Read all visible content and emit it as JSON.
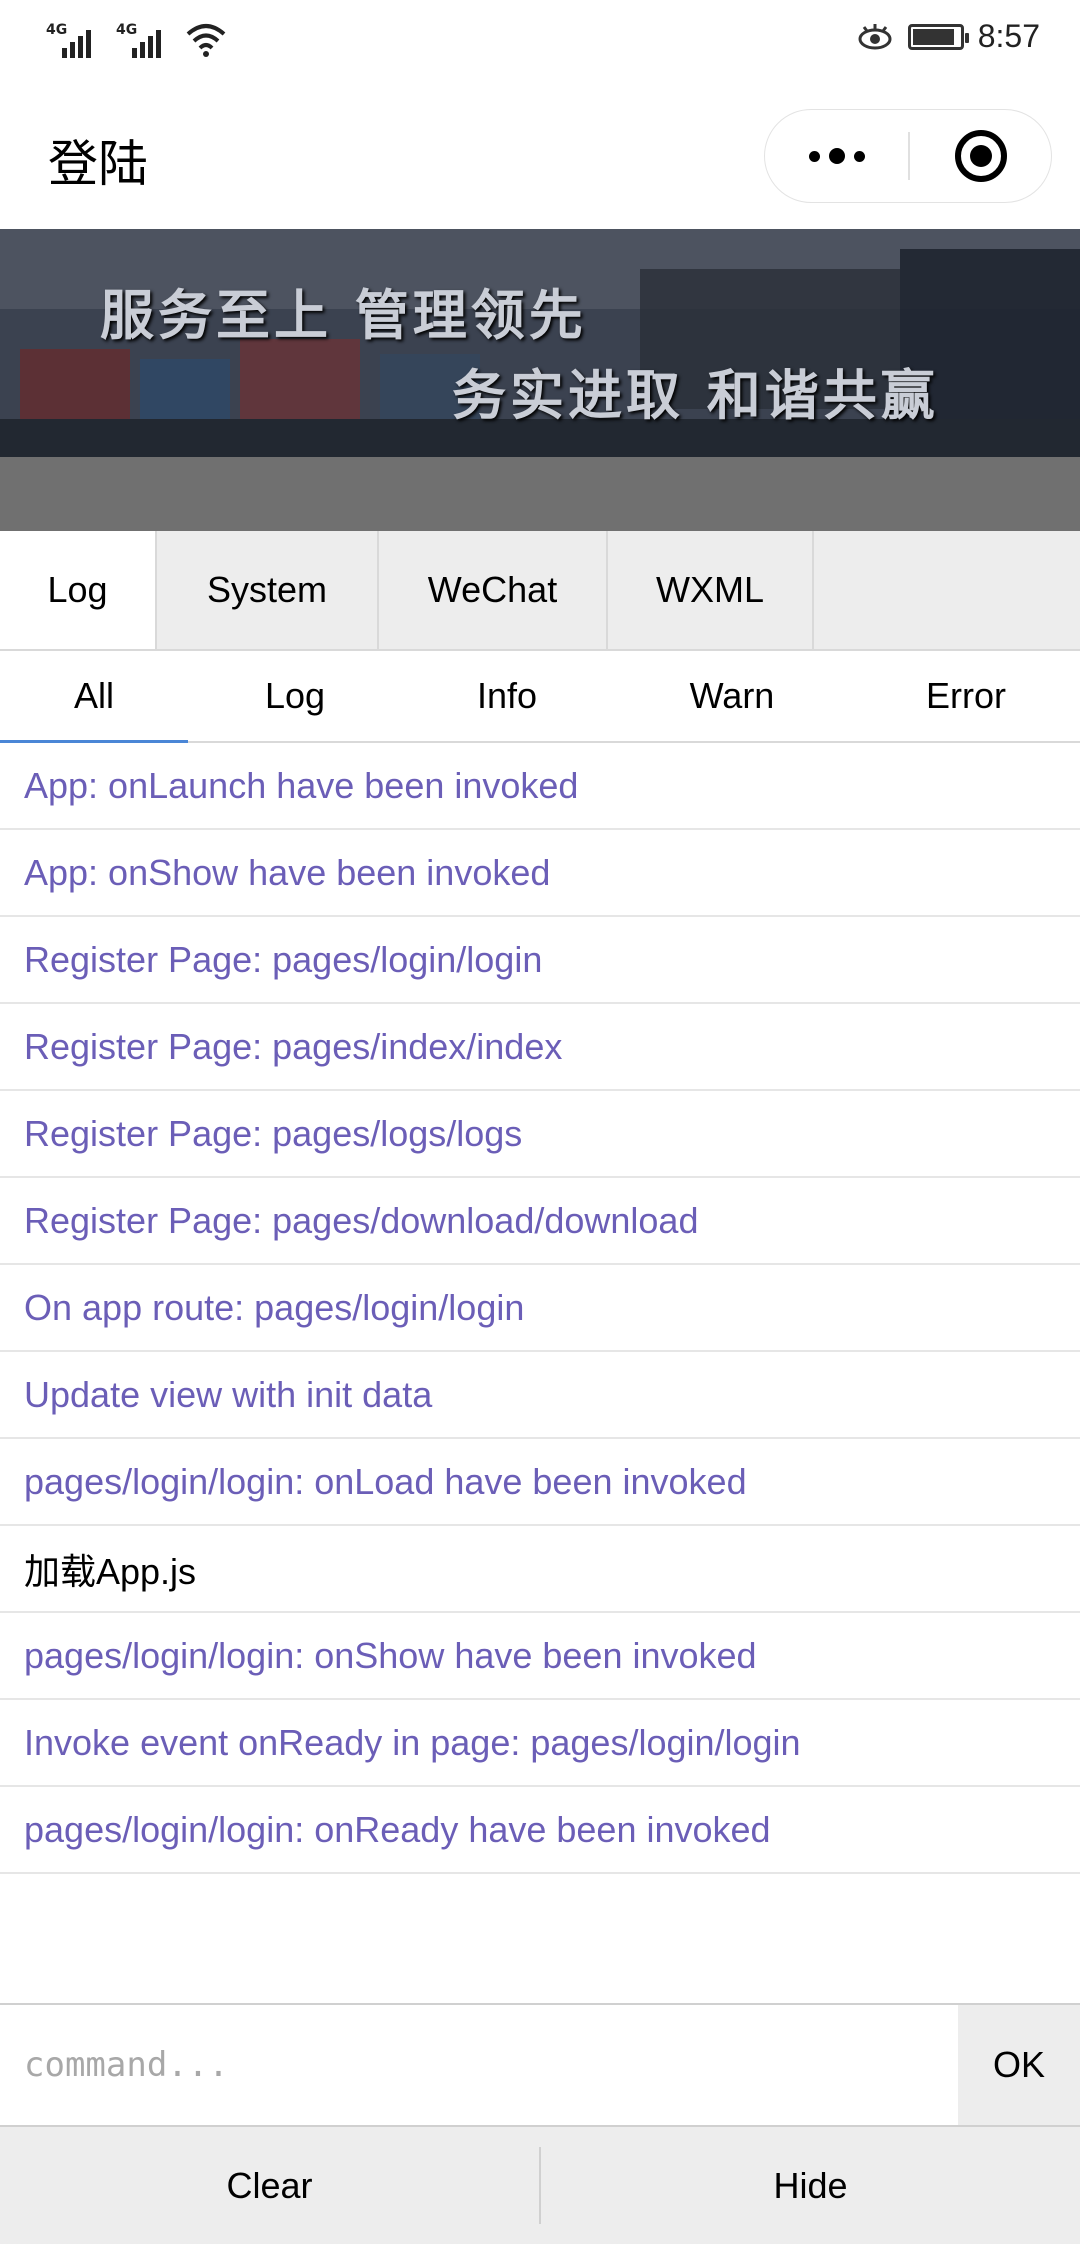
{
  "status_bar": {
    "signal1_label": "4G",
    "signal2_label": "4G",
    "time": "8:57",
    "battery_level": 0.9,
    "icons": [
      "signal-icon",
      "signal-icon",
      "wifi-icon",
      "eye-icon",
      "battery-icon"
    ]
  },
  "nav": {
    "title": "登陆",
    "more_icon": "more-dots-icon",
    "close_icon": "target-close-icon"
  },
  "banner": {
    "line1": "服务至上 管理领先",
    "line2": "务实进取 和谐共赢"
  },
  "console": {
    "tabs": [
      {
        "label": "Log",
        "active": true
      },
      {
        "label": "System",
        "active": false
      },
      {
        "label": "WeChat",
        "active": false
      },
      {
        "label": "WXML",
        "active": false
      }
    ],
    "subtabs": [
      {
        "label": "All",
        "active": true
      },
      {
        "label": "Log",
        "active": false
      },
      {
        "label": "Info",
        "active": false
      },
      {
        "label": "Warn",
        "active": false
      },
      {
        "label": "Error",
        "active": false
      }
    ],
    "logs": [
      {
        "text": "App: onLaunch have been invoked",
        "level": "info"
      },
      {
        "text": "App: onShow have been invoked",
        "level": "info"
      },
      {
        "text": "Register Page: pages/login/login",
        "level": "info"
      },
      {
        "text": "Register Page: pages/index/index",
        "level": "info"
      },
      {
        "text": "Register Page: pages/logs/logs",
        "level": "info"
      },
      {
        "text": "Register Page: pages/download/download",
        "level": "info"
      },
      {
        "text": "On app route: pages/login/login",
        "level": "info"
      },
      {
        "text": "Update view with init data",
        "level": "info"
      },
      {
        "text": "pages/login/login: onLoad have been invoked",
        "level": "info"
      },
      {
        "text": "加载App.js",
        "level": "log"
      },
      {
        "text": "pages/login/login: onShow have been invoked",
        "level": "info"
      },
      {
        "text": "Invoke event onReady in page: pages/login/login",
        "level": "info"
      },
      {
        "text": "pages/login/login: onReady have been invoked",
        "level": "info"
      }
    ],
    "command": {
      "placeholder": "command...",
      "value": "",
      "ok_label": "OK"
    },
    "bottom": {
      "clear_label": "Clear",
      "hide_label": "Hide"
    },
    "colors": {
      "info": "#6b5eb7",
      "log": "#000000",
      "tab_bg": "#ededed",
      "active_underline": "#4a86d6"
    }
  }
}
